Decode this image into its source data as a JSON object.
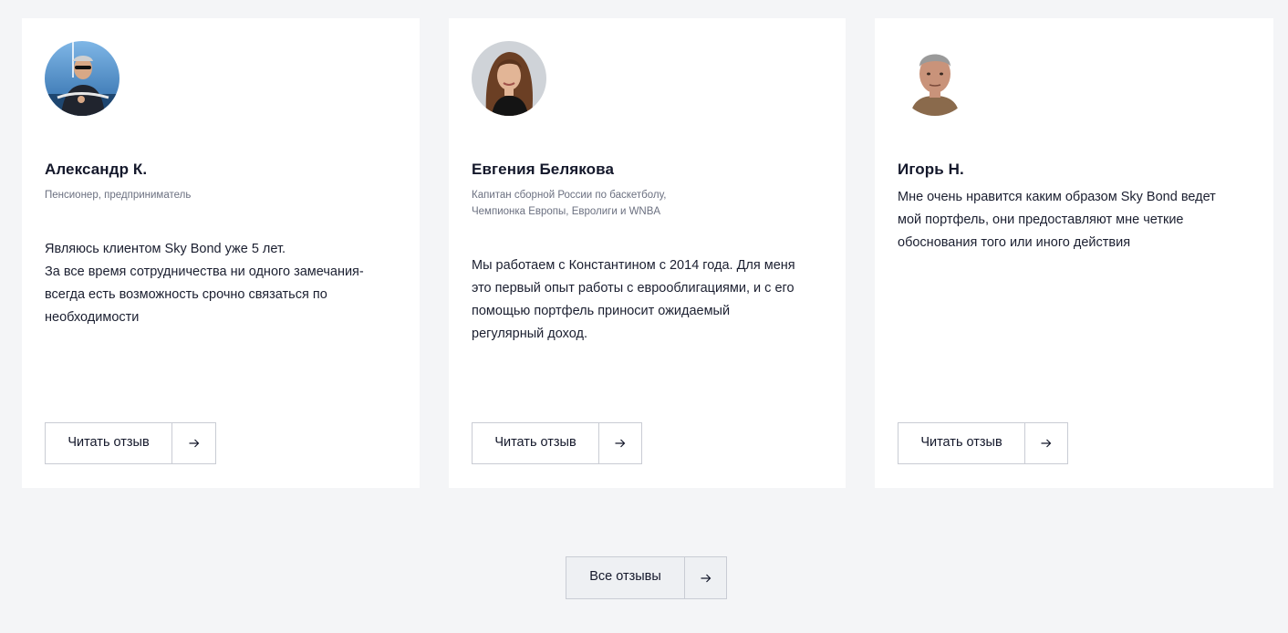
{
  "reviews": [
    {
      "name": "Александр К.",
      "role_lines": [
        "Пенсионер, предприниматель"
      ],
      "quote_lines": [
        "Являюсь клиентом Sky Bond уже 5 лет.",
        "За все время сотрудничества ни одного замечания-",
        "всегда есть возможность срочно связаться по",
        "необходимости"
      ],
      "button_label": "Читать отзыв",
      "avatar_icon": "portrait-photo-man-boat"
    },
    {
      "name": "Евгения Белякова",
      "role_lines": [
        "Капитан сборной России по баскетболу,",
        "Чемпионка Европы, Евролиги и WNBA"
      ],
      "quote_lines": [
        "Мы работаем с Константином с 2014 года. Для меня",
        "это первый опыт работы с еврооблигациями, и с его",
        "помощью портфель приносит ожидаемый",
        "регулярный доход."
      ],
      "button_label": "Читать отзыв",
      "avatar_icon": "portrait-photo-woman"
    },
    {
      "name": "Игорь Н.",
      "role_lines": [],
      "quote_lines": [
        "Мне очень нравится каким образом Sky Bond ведет",
        "мой портфель, они предоставляют мне четкие",
        "обоснования того или иного действия"
      ],
      "button_label": "Читать отзыв",
      "avatar_icon": "portrait-photo-man"
    }
  ],
  "all_reviews_button": {
    "label": "Все отзывы"
  },
  "colors": {
    "page_background": "#f4f5f7",
    "card_background": "#ffffff",
    "text_primary": "#14182b",
    "text_secondary": "#6b7080",
    "border": "#c9ccd4"
  }
}
